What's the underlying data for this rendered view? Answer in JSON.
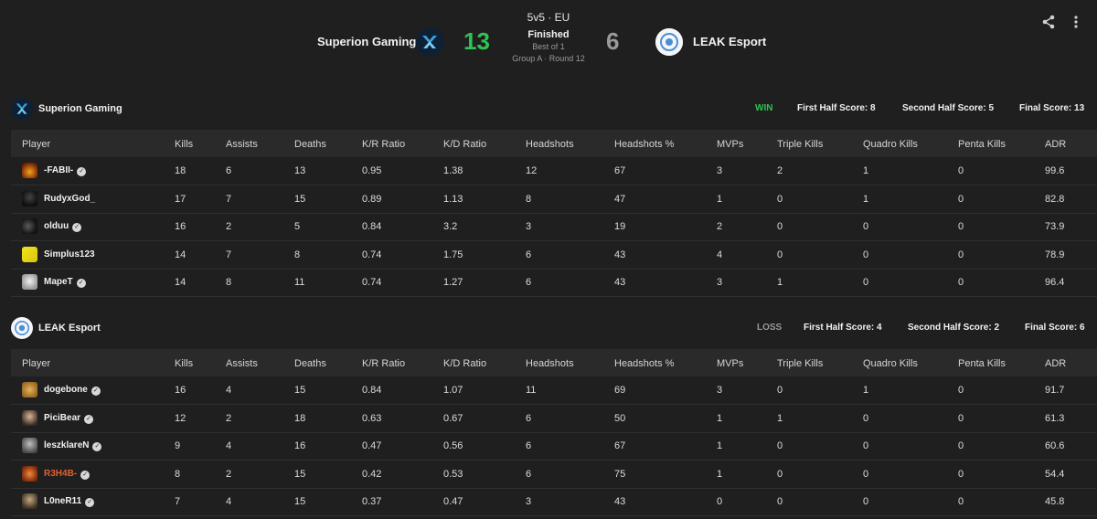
{
  "match": {
    "team1_name": "Superion Gaming",
    "team2_name": "LEAK Esport",
    "score1": "13",
    "score2": "6",
    "format": "5v5 · EU",
    "status": "Finished",
    "best_of": "Best of 1",
    "group_round": "Group A · Round 12",
    "score1_color": "#2fc451",
    "score2_color": "#9a9a9a"
  },
  "columns": [
    "Player",
    "Kills",
    "Assists",
    "Deaths",
    "K/R Ratio",
    "K/D Ratio",
    "Headshots",
    "Headshots %",
    "MVPs",
    "Triple Kills",
    "Quadro Kills",
    "Penta Kills",
    "ADR"
  ],
  "teams": [
    {
      "name": "Superion Gaming",
      "result": "WIN",
      "result_color": "#2fc451",
      "first_half": "First Half Score: 8",
      "second_half": "Second Half Score: 5",
      "final": "Final Score: 13",
      "players": [
        {
          "name": "-FABII-",
          "verified": true,
          "avatar": "orange-flame",
          "stats": [
            "18",
            "6",
            "13",
            "0.95",
            "1.38",
            "12",
            "67",
            "3",
            "2",
            "1",
            "0",
            "99.6"
          ]
        },
        {
          "name": "RudyxGod_",
          "verified": false,
          "avatar": "dark-figure",
          "stats": [
            "17",
            "7",
            "15",
            "0.89",
            "1.13",
            "8",
            "47",
            "1",
            "0",
            "1",
            "0",
            "82.8"
          ]
        },
        {
          "name": "olduu",
          "verified": true,
          "avatar": "dark-bird",
          "stats": [
            "16",
            "2",
            "5",
            "0.84",
            "3.2",
            "3",
            "19",
            "2",
            "0",
            "0",
            "0",
            "73.9"
          ]
        },
        {
          "name": "Simplus123",
          "verified": false,
          "avatar": "navi-logo",
          "stats": [
            "14",
            "7",
            "8",
            "0.74",
            "1.75",
            "6",
            "43",
            "4",
            "0",
            "0",
            "0",
            "78.9"
          ]
        },
        {
          "name": "MapeT",
          "verified": true,
          "avatar": "cartoon-face",
          "stats": [
            "14",
            "8",
            "11",
            "0.74",
            "1.27",
            "6",
            "43",
            "3",
            "1",
            "0",
            "0",
            "96.4"
          ]
        }
      ]
    },
    {
      "name": "LEAK Esport",
      "result": "LOSS",
      "result_color": "#9a9a9a",
      "first_half": "First Half Score: 4",
      "second_half": "Second Half Score: 2",
      "final": "Final Score: 6",
      "players": [
        {
          "name": "dogebone",
          "verified": true,
          "avatar": "doge",
          "stats": [
            "16",
            "4",
            "15",
            "0.84",
            "1.07",
            "11",
            "69",
            "3",
            "0",
            "1",
            "0",
            "91.7"
          ]
        },
        {
          "name": "PiciBear",
          "verified": true,
          "avatar": "portrait",
          "stats": [
            "12",
            "2",
            "18",
            "0.63",
            "0.67",
            "6",
            "50",
            "1",
            "1",
            "0",
            "0",
            "61.3"
          ]
        },
        {
          "name": "leszklareN",
          "verified": true,
          "avatar": "portrait-2",
          "stats": [
            "9",
            "4",
            "16",
            "0.47",
            "0.56",
            "6",
            "67",
            "1",
            "0",
            "0",
            "0",
            "60.6"
          ]
        },
        {
          "name": "R3H4B-",
          "verified": true,
          "name_color": "#e2622e",
          "avatar": "orange-art",
          "stats": [
            "8",
            "2",
            "15",
            "0.42",
            "0.53",
            "6",
            "75",
            "1",
            "0",
            "0",
            "0",
            "54.4"
          ]
        },
        {
          "name": "L0neR11",
          "verified": true,
          "avatar": "portrait-3",
          "stats": [
            "7",
            "4",
            "15",
            "0.37",
            "0.47",
            "3",
            "43",
            "0",
            "0",
            "0",
            "0",
            "45.8"
          ]
        }
      ]
    }
  ],
  "icons": {
    "share": "share-icon",
    "more": "more-vertical-icon",
    "verified": "verified-icon"
  }
}
